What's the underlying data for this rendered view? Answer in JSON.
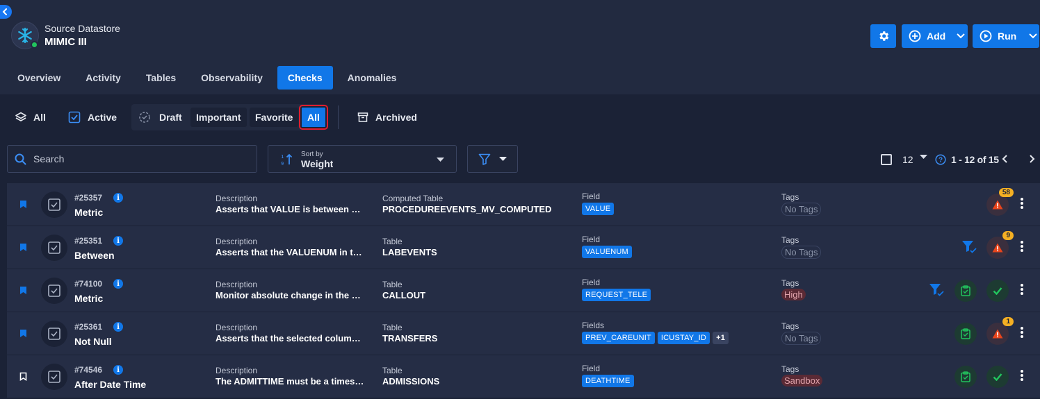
{
  "header": {
    "datastore_label": "Source Datastore",
    "datastore_name": "MIMIC III",
    "add_label": "Add",
    "run_label": "Run"
  },
  "tabs": [
    {
      "label": "Overview",
      "active": false
    },
    {
      "label": "Activity",
      "active": false
    },
    {
      "label": "Tables",
      "active": false
    },
    {
      "label": "Observability",
      "active": false
    },
    {
      "label": "Checks",
      "active": true
    },
    {
      "label": "Anomalies",
      "active": false
    }
  ],
  "filters": {
    "all": "All",
    "active": "Active",
    "draft": "Draft",
    "important": "Important",
    "favorite": "Favorite",
    "all_selected": "All",
    "archived": "Archived"
  },
  "toolbar": {
    "search_placeholder": "Search",
    "sort_by_label": "Sort by",
    "sort_value": "Weight",
    "per_page": "12",
    "range": "1 - 12 of 15"
  },
  "columns": {
    "description": "Description",
    "tags": "Tags"
  },
  "rows": [
    {
      "id": "#25357",
      "type": "Metric",
      "bookmarked": true,
      "description": "Asserts that VALUE is between MI…",
      "table_label": "Computed Table",
      "table": "PROCEDUREEVENTS_MV_COMPUTED",
      "field_label": "Field",
      "fields": [
        "VALUE"
      ],
      "more": "",
      "tag": "No Tags",
      "tag_style": "none",
      "anomalies": "58",
      "status": "anomaly",
      "filter_icon": false,
      "validate_icon": false
    },
    {
      "id": "#25351",
      "type": "Between",
      "bookmarked": true,
      "description": "Asserts that the VALUENUM in th…",
      "table_label": "Table",
      "table": "LABEVENTS",
      "field_label": "Field",
      "fields": [
        "VALUENUM"
      ],
      "more": "",
      "tag": "No Tags",
      "tag_style": "none",
      "anomalies": "9",
      "status": "anomaly",
      "filter_icon": true,
      "validate_icon": false
    },
    {
      "id": "#74100",
      "type": "Metric",
      "bookmarked": true,
      "description": "Monitor absolute change in the m…",
      "table_label": "Table",
      "table": "CALLOUT",
      "field_label": "Field",
      "fields": [
        "REQUEST_TELE"
      ],
      "more": "",
      "tag": "High",
      "tag_style": "red",
      "anomalies": "",
      "status": "pass",
      "filter_icon": true,
      "validate_icon": true
    },
    {
      "id": "#25361",
      "type": "Not Null",
      "bookmarked": true,
      "description": "Asserts that the selected column…",
      "table_label": "Table",
      "table": "TRANSFERS",
      "field_label": "Fields",
      "fields": [
        "PREV_CAREUNIT",
        "ICUSTAY_ID"
      ],
      "more": "+1",
      "tag": "No Tags",
      "tag_style": "none",
      "anomalies": "1",
      "status": "anomaly",
      "filter_icon": false,
      "validate_icon": true
    },
    {
      "id": "#74546",
      "type": "After Date Time",
      "bookmarked": false,
      "description": "The ADMITTIME must be a timest…",
      "table_label": "Table",
      "table": "ADMISSIONS",
      "field_label": "Field",
      "fields": [
        "DEATHTIME"
      ],
      "more": "",
      "tag": "Sandbox",
      "tag_style": "red",
      "anomalies": "",
      "status": "pass",
      "filter_icon": false,
      "validate_icon": true
    }
  ],
  "colors": {
    "accent": "#1177e8",
    "background": "#1b2236",
    "row": "#252d45",
    "warning": "#f5b023",
    "danger": "#e8451c",
    "success": "#22c55e"
  },
  "icons": {
    "bookmark": "bookmark-icon",
    "check_type": "check-square-icon",
    "info": "info-icon",
    "anomaly": "warning-triangle-icon",
    "pass": "checkmark-icon",
    "filter": "filter-check-icon",
    "validate": "clipboard-check-icon",
    "kebab": "kebab-icon"
  }
}
